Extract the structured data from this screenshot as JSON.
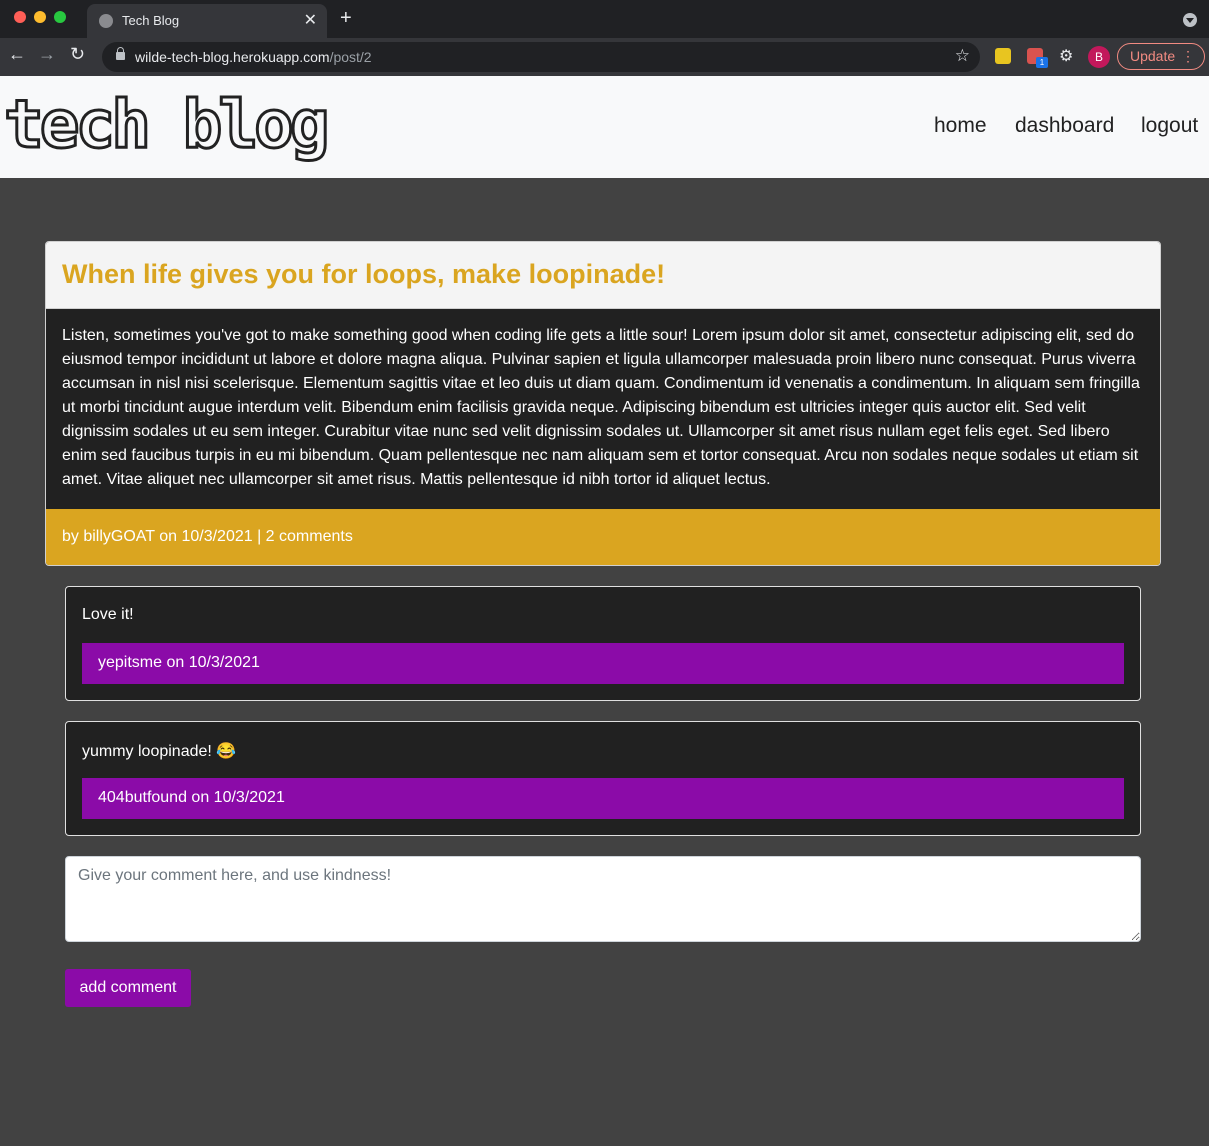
{
  "browser": {
    "tab_title": "Tech Blog",
    "tab_close": "✕",
    "new_tab": "+",
    "url_domain": "wilde-tech-blog.herokuapp.com",
    "url_path": "/post/2",
    "ext_badge": "1",
    "profile_initial": "B",
    "update_label": "Update"
  },
  "site": {
    "logo_text": "tech blog",
    "nav": {
      "home": "home",
      "dashboard": "dashboard",
      "logout": "logout"
    }
  },
  "post": {
    "title": "When life gives you for loops, make loopinade!",
    "body": "Listen, sometimes you've got to make something good when coding life gets a little sour! Lorem ipsum dolor sit amet, consectetur adipiscing elit, sed do eiusmod tempor incididunt ut labore et dolore magna aliqua. Pulvinar sapien et ligula ullamcorper malesuada proin libero nunc consequat. Purus viverra accumsan in nisl nisi scelerisque. Elementum sagittis vitae et leo duis ut diam quam. Condimentum id venenatis a condimentum. In aliquam sem fringilla ut morbi tincidunt augue interdum velit. Bibendum enim facilisis gravida neque. Adipiscing bibendum est ultricies integer quis auctor elit. Sed velit dignissim sodales ut eu sem integer. Curabitur vitae nunc sed velit dignissim sodales ut. Ullamcorper sit amet risus nullam eget felis eget. Sed libero enim sed faucibus turpis in eu mi bibendum. Quam pellentesque nec nam aliquam sem et tortor consequat. Arcu non sodales neque sodales ut etiam sit amet. Vitae aliquet nec ullamcorper sit amet risus. Mattis pellentesque id nibh tortor id aliquet lectus.",
    "footer": "by billyGOAT on 10/3/2021 | 2 comments"
  },
  "comments": [
    {
      "text": "Love it!",
      "meta": "yepitsme on 10/3/2021"
    },
    {
      "text": "yummy loopinade! 😂",
      "meta": "404butfound on 10/3/2021"
    }
  ],
  "comment_form": {
    "placeholder": "Give your comment here, and use kindness!",
    "value": "",
    "submit_label": "add comment"
  },
  "colors": {
    "page_bg": "#424242",
    "accent_gold": "#daa520",
    "accent_purple": "#8b0ba8",
    "card_dark": "#212121"
  }
}
